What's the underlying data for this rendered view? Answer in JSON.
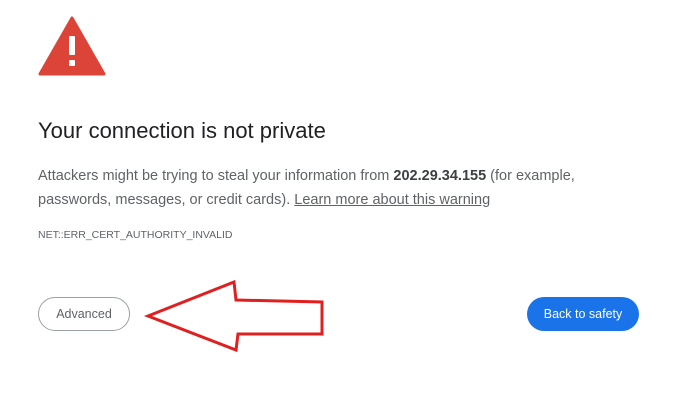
{
  "icons": {
    "warning": "warning-triangle-icon",
    "annotation": "red-arrow-annotation"
  },
  "colors": {
    "warning_red": "#d93025",
    "accent_blue": "#1a73e8",
    "annotation_red": "#e02020"
  },
  "interstitial": {
    "title": "Your connection is not private",
    "description_before": "Attackers might be trying to steal your information from ",
    "host": "202.29.34.155",
    "description_after": " (for example, passwords, messages, or credit cards). ",
    "learn_more_link": "Learn more about this warning",
    "error_code": "NET::ERR_CERT_AUTHORITY_INVALID"
  },
  "buttons": {
    "advanced": "Advanced",
    "back_to_safety": "Back to safety"
  }
}
